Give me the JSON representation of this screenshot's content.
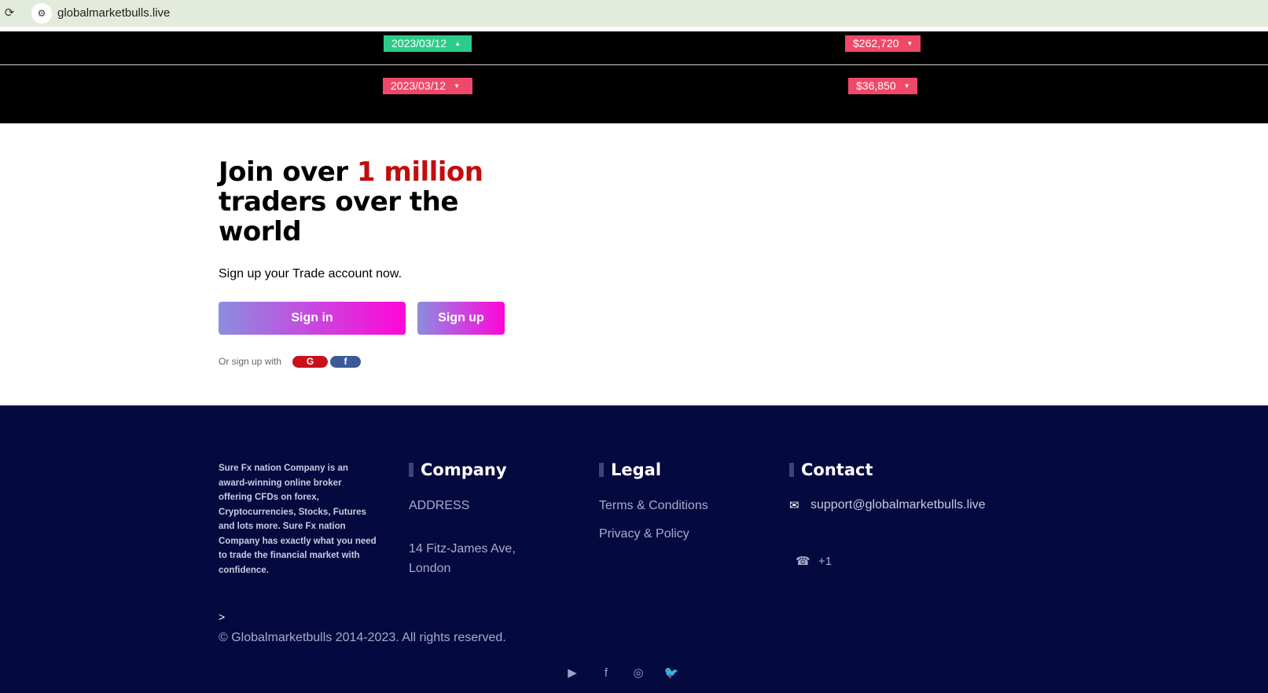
{
  "browser": {
    "url": "globalmarketbulls.live",
    "reload_glyph": "⟳",
    "settings_glyph": "⚙"
  },
  "ticker": {
    "rows": [
      {
        "date": "2023/03/12",
        "date_trend": "up",
        "amount": "$262,720",
        "amount_trend": "down"
      },
      {
        "date": "2023/03/12",
        "date_trend": "down",
        "amount": "$36,850",
        "amount_trend": "down"
      }
    ],
    "arrow_up": "▲",
    "arrow_down": "▼"
  },
  "join": {
    "headline_pre": "Join over ",
    "headline_highlight": "1 million",
    "headline_post": " traders over the world",
    "subline": "Sign up your Trade account now.",
    "signin_label": "Sign in",
    "signup_label": "Sign up",
    "or_text": "Or sign up with",
    "google_glyph": "G",
    "facebook_glyph": "f"
  },
  "footer": {
    "about": "Sure Fx nation Company is an award-winning online broker offering CFDs on forex, Cryptocurrencies, Stocks, Futures and lots more. Sure Fx nation Company has exactly what you need to trade the financial market with confidence.",
    "company_title": "Company",
    "address_label": "ADDRESS",
    "address": "14 Fitz-James Ave, London",
    "legal_title": "Legal",
    "terms": "Terms & Conditions",
    "privacy": "Privacy & Policy",
    "contact_title": "Contact",
    "email": "support@globalmarketbulls.live",
    "phone": "+1",
    "email_glyph": "✉",
    "phone_glyph": "☎",
    "gt": ">",
    "copyright": "© Globalmarketbulls 2014-2023. All rights reserved.",
    "social": [
      {
        "name": "youtube-icon",
        "glyph": "▶"
      },
      {
        "name": "facebook-icon",
        "glyph": "f"
      },
      {
        "name": "instagram-icon",
        "glyph": "◎"
      },
      {
        "name": "twitter-icon",
        "glyph": "🐦"
      }
    ]
  },
  "colors": {
    "ticker_up": "#2dcb8a",
    "ticker_down": "#f04868",
    "highlight": "#c20d0d",
    "footer_bg": "#04093f",
    "google": "#c8111b",
    "facebook": "#3b5998"
  }
}
